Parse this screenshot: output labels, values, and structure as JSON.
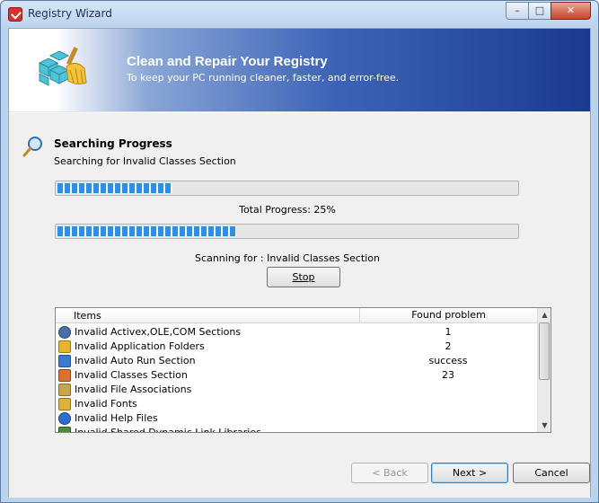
{
  "window": {
    "title": "Registry Wizard",
    "controls": {
      "minimize": "–",
      "maximize": "□",
      "close": "✕"
    }
  },
  "header": {
    "title": "Clean and Repair Your Registry",
    "subtitle": "To keep your PC running cleaner, faster, and error-free."
  },
  "progress": {
    "title": "Searching Progress",
    "current_section": "Searching for Invalid Classes Section",
    "section_progress": 0.25,
    "total_progress_label": "Total Progress: 25%",
    "total_progress": 0.39,
    "scanning_label": "Scanning for : Invalid Classes Section",
    "stop_label": "Stop"
  },
  "list": {
    "col_items": "Items",
    "col_found": "Found problem",
    "rows": [
      {
        "name": "Invalid Activex,OLE,COM Sections",
        "value": "1",
        "icon": "gear-icon",
        "color": "#4a6fa8"
      },
      {
        "name": "Invalid Application Folders",
        "value": "2",
        "icon": "folder-check-icon",
        "color": "#e8b52b"
      },
      {
        "name": "Invalid Auto Run Section",
        "value": "success",
        "icon": "autorun-icon",
        "color": "#3b7ad1"
      },
      {
        "name": "Invalid Classes Section",
        "value": "23",
        "icon": "classes-icon",
        "color": "#d9722b"
      },
      {
        "name": "Invalid File Associations",
        "value": "",
        "icon": "file-association-icon",
        "color": "#c9a64a"
      },
      {
        "name": "Invalid Fonts",
        "value": "",
        "icon": "fonts-folder-icon",
        "color": "#e0b03a"
      },
      {
        "name": "Invalid Help Files",
        "value": "",
        "icon": "help-icon",
        "color": "#2c6fd0"
      },
      {
        "name": "Invalid Shared Dynamic Link Libraries",
        "value": "",
        "icon": "dll-icon",
        "color": "#4a8a3a"
      }
    ]
  },
  "buttons": {
    "back": "< Back",
    "next": "Next >",
    "cancel": "Cancel"
  }
}
